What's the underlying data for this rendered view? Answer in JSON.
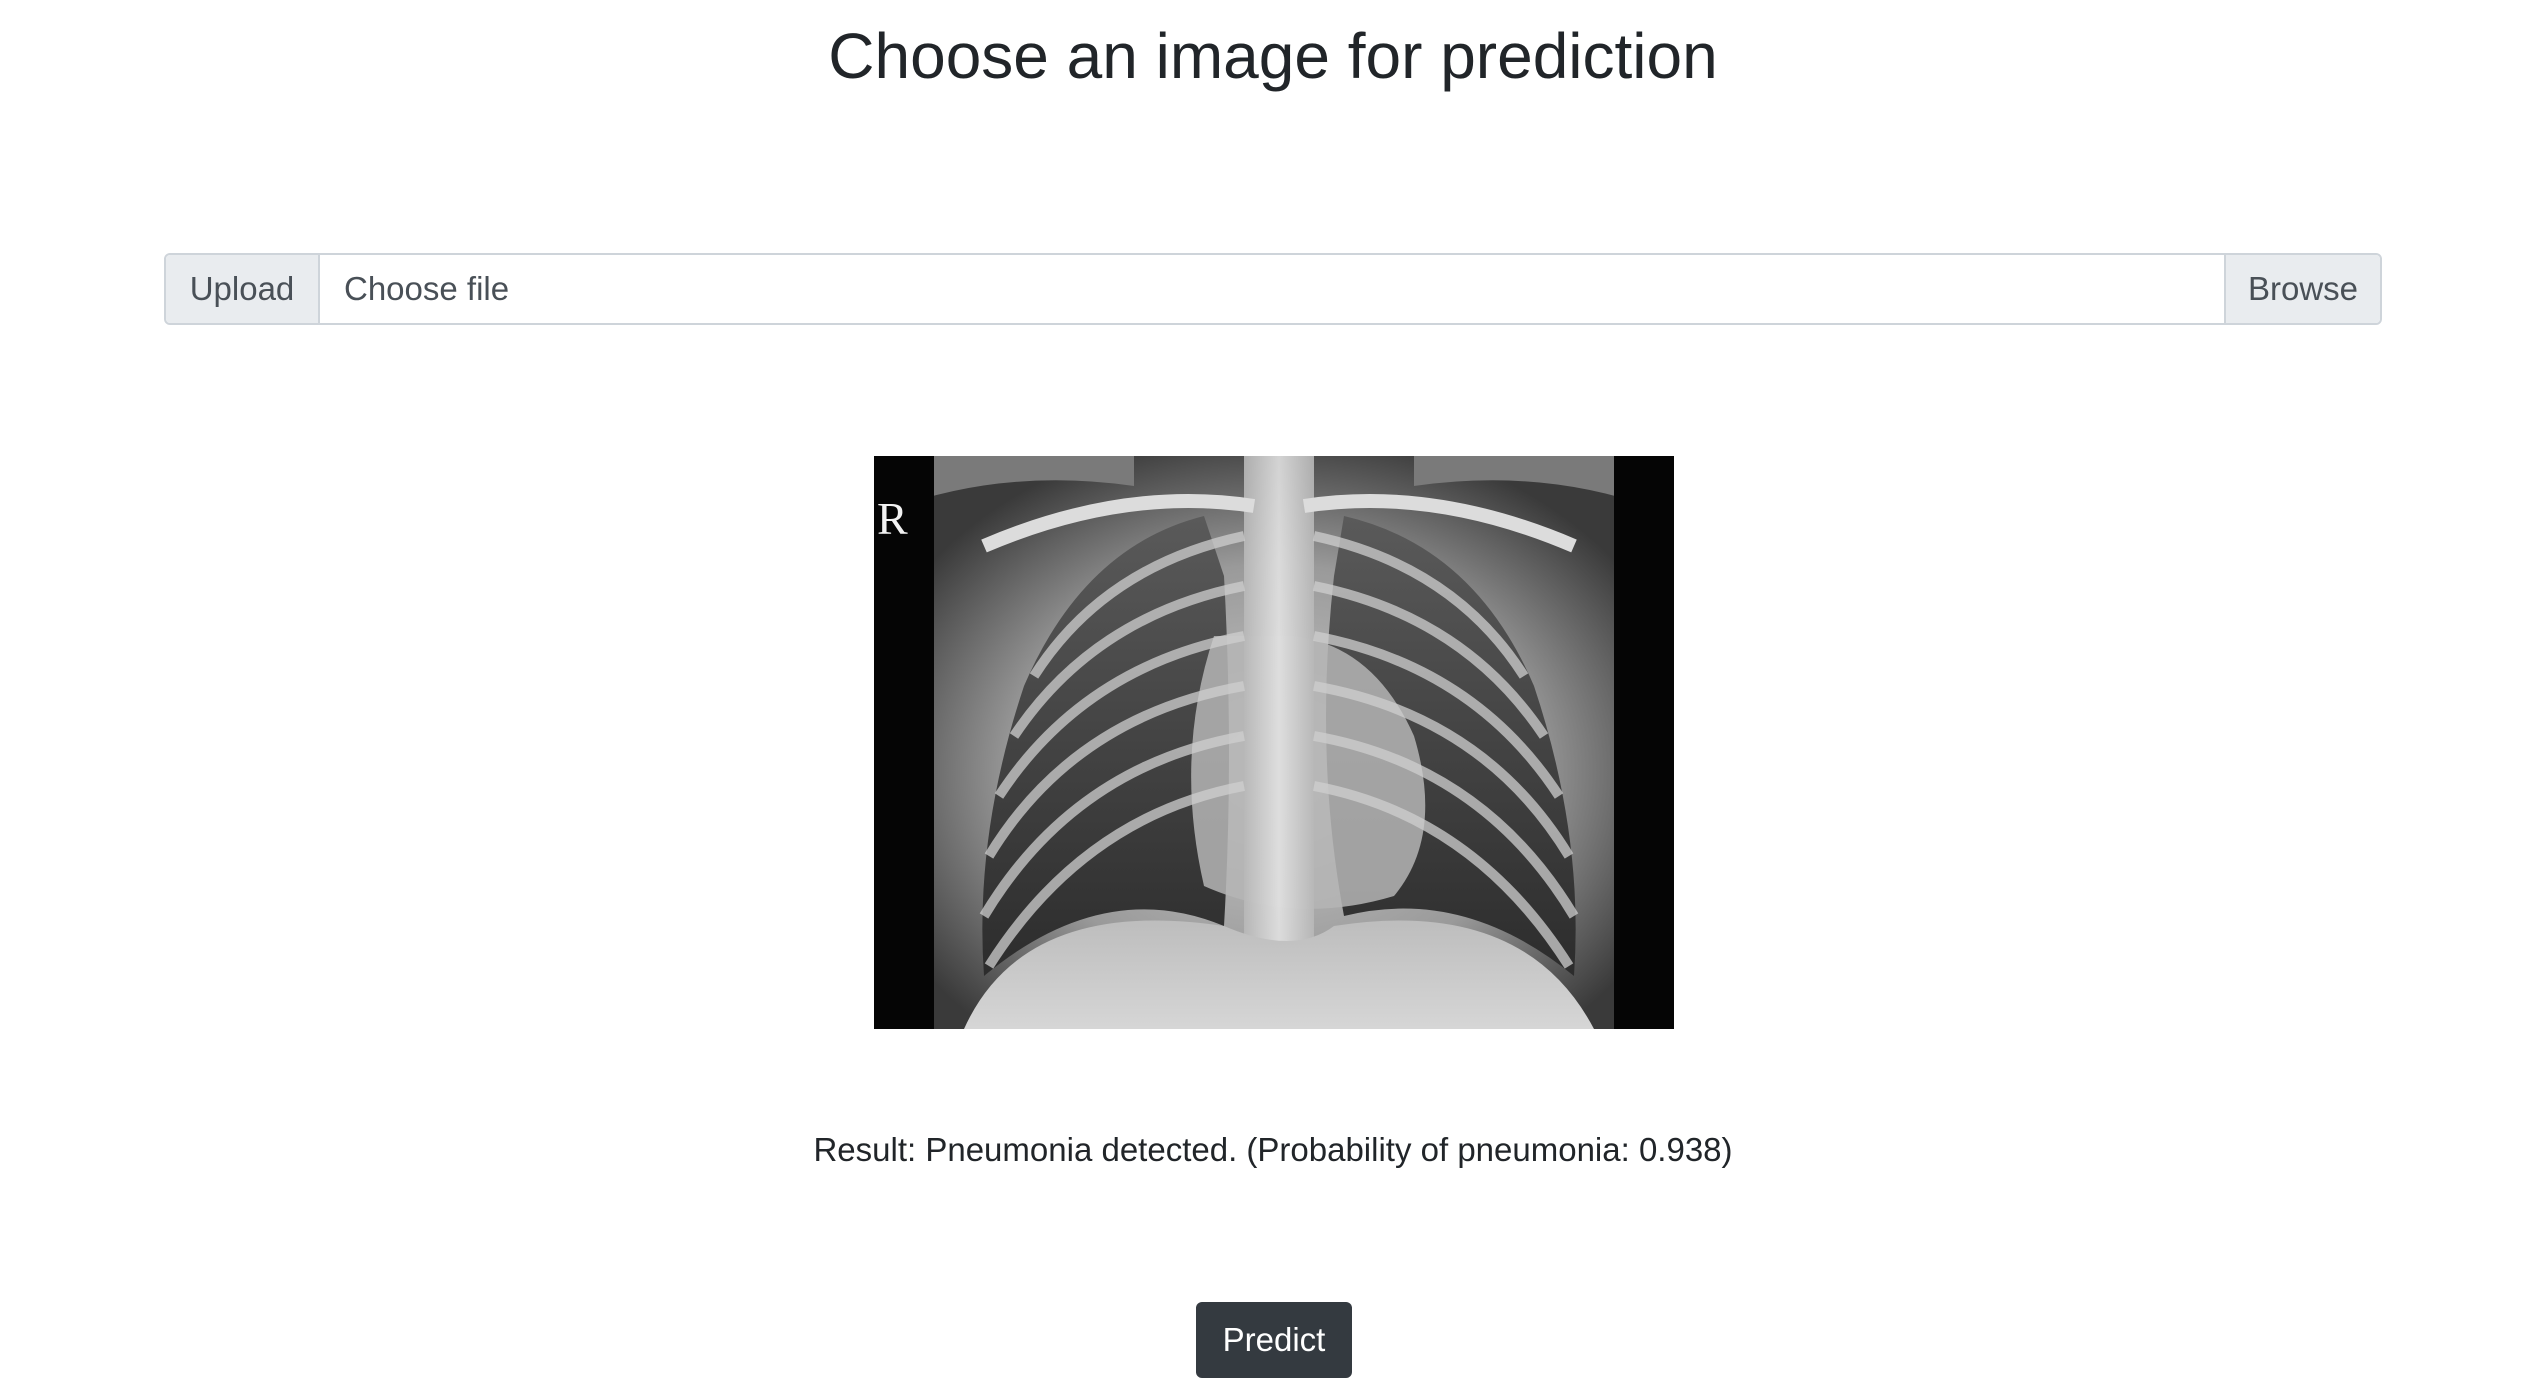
{
  "page": {
    "title": "Choose an image for prediction"
  },
  "upload": {
    "prepend_label": "Upload",
    "file_placeholder": "Choose file",
    "browse_label": "Browse"
  },
  "preview": {
    "image_icon": "chest-xray-image",
    "marker_letter": "R"
  },
  "result": {
    "text": "Result: Pneumonia detected. (Probability of pneumonia: 0.938)"
  },
  "actions": {
    "predict_label": "Predict"
  },
  "colors": {
    "primary_text": "#212529",
    "input_border": "#ced4da",
    "addon_bg": "#e9ecef",
    "button_dark": "#343a40"
  }
}
